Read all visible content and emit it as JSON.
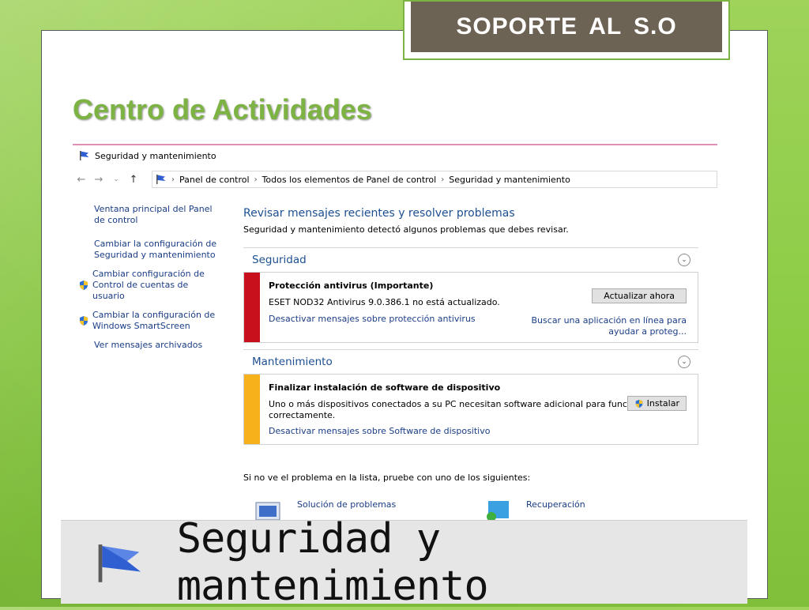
{
  "banner": {
    "text": "SOPORTE  AL  S.O"
  },
  "slide_title": "Centro de Actividades",
  "window": {
    "title": "Seguridad y mantenimiento",
    "breadcrumb": [
      "Panel de control",
      "Todos los elementos de Panel de control",
      "Seguridad y mantenimiento"
    ]
  },
  "sidebar": {
    "items": [
      {
        "label": "Ventana principal del Panel de control",
        "icon": ""
      },
      {
        "label": "Cambiar la configuración de Seguridad y mantenimiento",
        "icon": ""
      },
      {
        "label": "Cambiar configuración de Control de cuentas de usuario",
        "icon": "shield-icon"
      },
      {
        "label": "Cambiar la configuración de Windows SmartScreen",
        "icon": "shield-icon"
      },
      {
        "label": "Ver mensajes archivados",
        "icon": ""
      }
    ]
  },
  "main": {
    "heading": "Revisar mensajes recientes y resolver problemas",
    "subheading": "Seguridad y mantenimiento detectó algunos problemas que debes revisar.",
    "security": {
      "title": "Seguridad",
      "panel_title": "Protección antivirus  (Importante)",
      "panel_text": "ESET NOD32 Antivirus 9.0.386.1 no está actualizado.",
      "button": "Actualizar ahora",
      "left_link": "Desactivar mensajes sobre protección antivirus",
      "right_link_line1": "Buscar una aplicación en línea para",
      "right_link_line2": "ayudar a proteg...",
      "bar_color": "#c8101d"
    },
    "maintenance": {
      "title": "Mantenimiento",
      "panel_title": "Finalizar instalación de software de dispositivo",
      "panel_text_line1": "Uno o más dispositivos conectados a su PC necesitan software adicional para funcionar",
      "panel_text_line2": "correctamente.",
      "button": "Instalar",
      "link": "Desactivar mensajes sobre Software de dispositivo",
      "bar_color": "#f7b21b"
    },
    "bottom_text": "Si no ve el problema en la lista, pruebe con uno de los siguientes:",
    "tools": [
      {
        "label": "Solución de problemas"
      },
      {
        "label": "Recuperación"
      }
    ]
  },
  "zoom": {
    "text": "Seguridad y mantenimiento"
  },
  "colors": {
    "accent": "#7cb342",
    "link": "#1a3d85",
    "banner": "#6d6355"
  }
}
